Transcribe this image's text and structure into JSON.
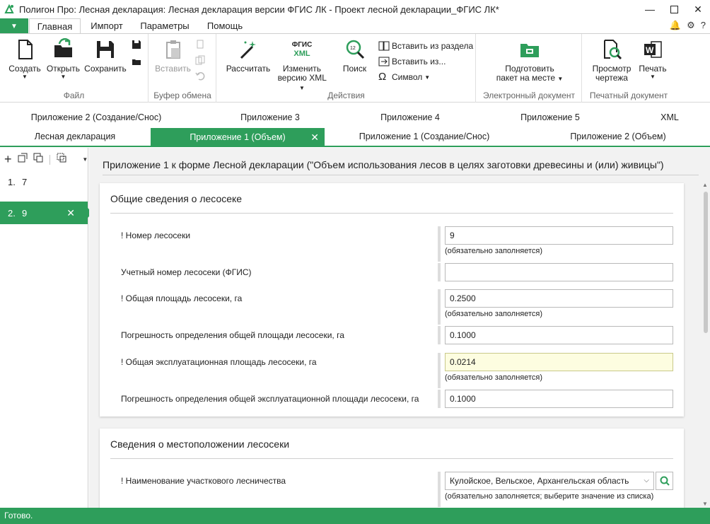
{
  "window": {
    "title": "Полигон Про: Лесная декларация: Лесная декларация версии ФГИС ЛК - Проект лесной декларации_ФГИС ЛК*"
  },
  "ribbon_tabs": [
    "Главная",
    "Импорт",
    "Параметры",
    "Помощь"
  ],
  "ribbon": {
    "groups": {
      "file": "Файл",
      "clipboard": "Буфер обмена",
      "actions": "Действия",
      "edoc": "Электронный документ",
      "print": "Печатный документ"
    },
    "buttons": {
      "create": "Создать",
      "open": "Открыть",
      "save": "Сохранить",
      "paste": "Вставить",
      "calculate": "Рассчитать",
      "fgis_icon_top": "ФГИС",
      "fgis_icon_bottom": "XML",
      "change_xml_1": "Изменить",
      "change_xml_2": "версию XML",
      "search": "Поиск",
      "insert_from_section": "Вставить из раздела",
      "insert_from": "Вставить из...",
      "symbol": "Символ",
      "prepare_1": "Подготовить",
      "prepare_2": "пакет на месте",
      "preview_1": "Просмотр",
      "preview_2": "чертежа",
      "print": "Печать"
    }
  },
  "doc_tabs_row1": [
    "Приложение 2 (Создание/Снос)",
    "Приложение 3",
    "Приложение 4",
    "Приложение 5",
    "XML"
  ],
  "doc_tabs_row2": [
    "Лесная декларация",
    "Приложение 1 (Объем)",
    "Приложение 1 (Создание/Снос)",
    "Приложение 2 (Объем)"
  ],
  "left_list": [
    {
      "num": "1.",
      "label": "7"
    },
    {
      "num": "2.",
      "label": "9"
    }
  ],
  "page_heading": "Приложение 1 к форме Лесной декларации (\"Объем использования лесов в целях заготовки древесины и (или) живицы\")",
  "section1": {
    "title": "Общие сведения о лесосеке",
    "fields": [
      {
        "label": "! Номер лесосеки",
        "value": "9",
        "hint": "(обязательно заполняется)"
      },
      {
        "label": "Учетный номер лесосеки (ФГИС)",
        "value": "",
        "hint": ""
      },
      {
        "label": "! Общая площадь лесосеки, га",
        "value": "0.2500",
        "hint": "(обязательно заполняется)"
      },
      {
        "label": "Погрешность определения общей площади лесосеки, га",
        "value": "0.1000",
        "hint": ""
      },
      {
        "label": "! Общая эксплуатационная площадь лесосеки, га",
        "value": "0.0214",
        "hint": "(обязательно заполняется)"
      },
      {
        "label": "Погрешность определения общей эксплуатационной площади лесосеки, га",
        "value": "0.1000",
        "hint": ""
      }
    ]
  },
  "section2": {
    "title": "Сведения о местоположении лесосеки",
    "field": {
      "label": "! Наименование участкового лесничества",
      "value": "Кулойское, Вельское, Архангельская область",
      "hint": "(обязательно заполняется; выберите значение из списка)"
    }
  },
  "status": "Готово.",
  "colors": {
    "accent": "#2e9e5b",
    "highlight_input": "#fdfde0"
  }
}
